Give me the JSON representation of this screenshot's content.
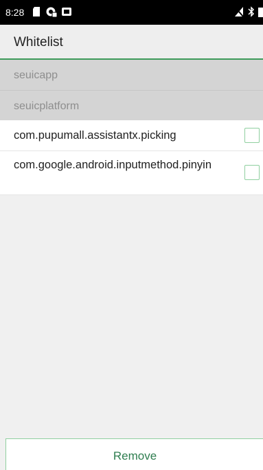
{
  "status_bar": {
    "time": "8:28",
    "icons_left": [
      "sim-card-icon",
      "notification-app-icon",
      "media-icon"
    ],
    "icons_right": [
      "no-signal-icon",
      "bluetooth-icon",
      "battery-icon"
    ]
  },
  "app_bar": {
    "title": "Whitelist"
  },
  "system_apps": [
    {
      "label": "seuicapp"
    },
    {
      "label": "seuicplatform"
    }
  ],
  "apps": [
    {
      "label": "com.pupumall.assistantx.picking",
      "checked": false
    },
    {
      "label": "com.google.android.inputmethod.pinyin",
      "checked": false
    }
  ],
  "footer": {
    "remove_label": "Remove"
  },
  "colors": {
    "accent": "#3d9a5a",
    "checkbox_border": "#8fcf9f",
    "button_text": "#2e7d4f",
    "disabled_bg": "#d4d4d4",
    "disabled_text": "#8e8e8e"
  }
}
